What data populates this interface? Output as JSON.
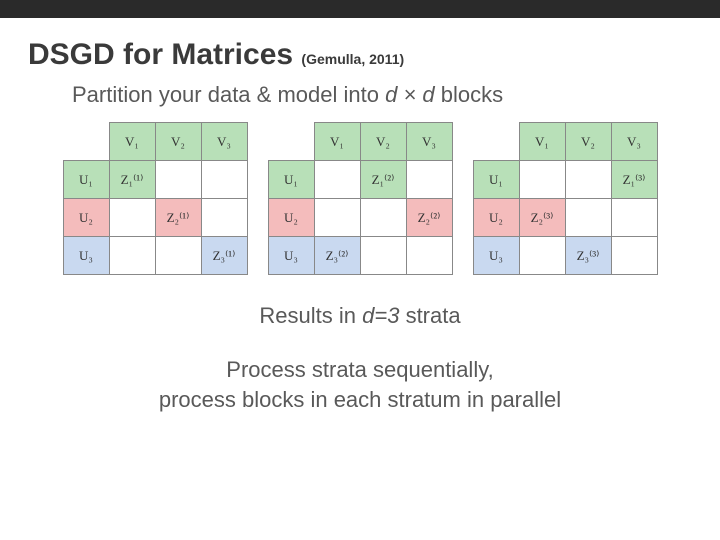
{
  "topbar": {},
  "title": {
    "main": "DSGD for Matrices",
    "cite": "(Gemulla, 2011)"
  },
  "subtitle": {
    "pre": "Partition your data & model into ",
    "dxd": "d × d",
    "post": " blocks"
  },
  "colors": {
    "green": "#b8e0b8",
    "pink": "#f4bcbc",
    "blue": "#c9d9f0"
  },
  "labels": {
    "V": [
      "V₁",
      "V₂",
      "V₃"
    ],
    "U": [
      "U₁",
      "U₂",
      "U₃"
    ]
  },
  "matrices": [
    {
      "stratum": 1,
      "z_cells": [
        {
          "row": 0,
          "col": 0,
          "label": "Z₁⁽¹⁾",
          "color": "green"
        },
        {
          "row": 1,
          "col": 1,
          "label": "Z₂⁽¹⁾",
          "color": "pink"
        },
        {
          "row": 2,
          "col": 2,
          "label": "Z₃⁽¹⁾",
          "color": "blue"
        }
      ]
    },
    {
      "stratum": 2,
      "z_cells": [
        {
          "row": 0,
          "col": 1,
          "label": "Z₁⁽²⁾",
          "color": "green"
        },
        {
          "row": 1,
          "col": 2,
          "label": "Z₂⁽²⁾",
          "color": "pink"
        },
        {
          "row": 2,
          "col": 0,
          "label": "Z₃⁽²⁾",
          "color": "blue"
        }
      ]
    },
    {
      "stratum": 3,
      "z_cells": [
        {
          "row": 0,
          "col": 2,
          "label": "Z₁⁽³⁾",
          "color": "green"
        },
        {
          "row": 1,
          "col": 0,
          "label": "Z₂⁽³⁾",
          "color": "pink"
        },
        {
          "row": 2,
          "col": 1,
          "label": "Z₃⁽³⁾",
          "color": "blue"
        }
      ]
    }
  ],
  "results": {
    "pre": "Results in ",
    "dval": "d=3",
    "post": " strata"
  },
  "conclusion": {
    "line1": "Process strata sequentially,",
    "line2": "process blocks in each stratum in parallel"
  }
}
